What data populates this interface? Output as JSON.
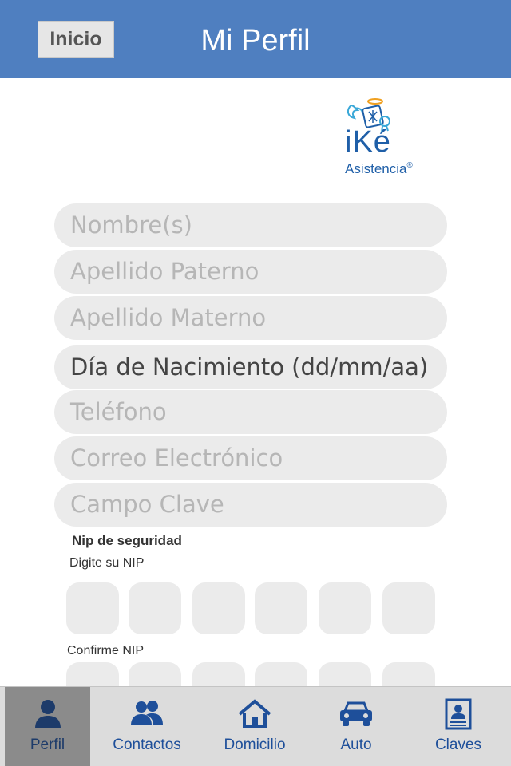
{
  "header": {
    "home_button": "Inicio",
    "title": "Mi Perfil",
    "background": "#4f7fc0"
  },
  "logo": {
    "name": "ike-angel-logo",
    "wordmark": "iKé",
    "subtitle": "Asistencia",
    "registered": "®",
    "color": "#1f5fa8"
  },
  "form": {
    "fields": [
      {
        "placeholder": "Nombre(s)",
        "state": "empty"
      },
      {
        "placeholder": "Apellido Paterno",
        "state": "empty"
      },
      {
        "placeholder": "Apellido Materno",
        "state": "empty"
      },
      {
        "placeholder": "Día de Nacimiento (dd/mm/aa)",
        "state": "filled-style"
      },
      {
        "placeholder": "Teléfono",
        "state": "empty"
      },
      {
        "placeholder": "Correo Electrónico",
        "state": "empty"
      },
      {
        "placeholder": "Campo Clave",
        "state": "empty"
      }
    ]
  },
  "nip": {
    "title": "Nip de seguridad",
    "enter_label": "Digite su NIP",
    "confirm_label": "Confirme NIP",
    "digits": 6
  },
  "tabbar": {
    "active_tab": "Perfil",
    "tabs": [
      {
        "label": "Perfil",
        "icon": "person-icon"
      },
      {
        "label": "Contactos",
        "icon": "contacts-icon"
      },
      {
        "label": "Domicilio",
        "icon": "home-icon"
      },
      {
        "label": "Auto",
        "icon": "car-icon"
      },
      {
        "label": "Claves",
        "icon": "id-card-icon"
      }
    ]
  }
}
